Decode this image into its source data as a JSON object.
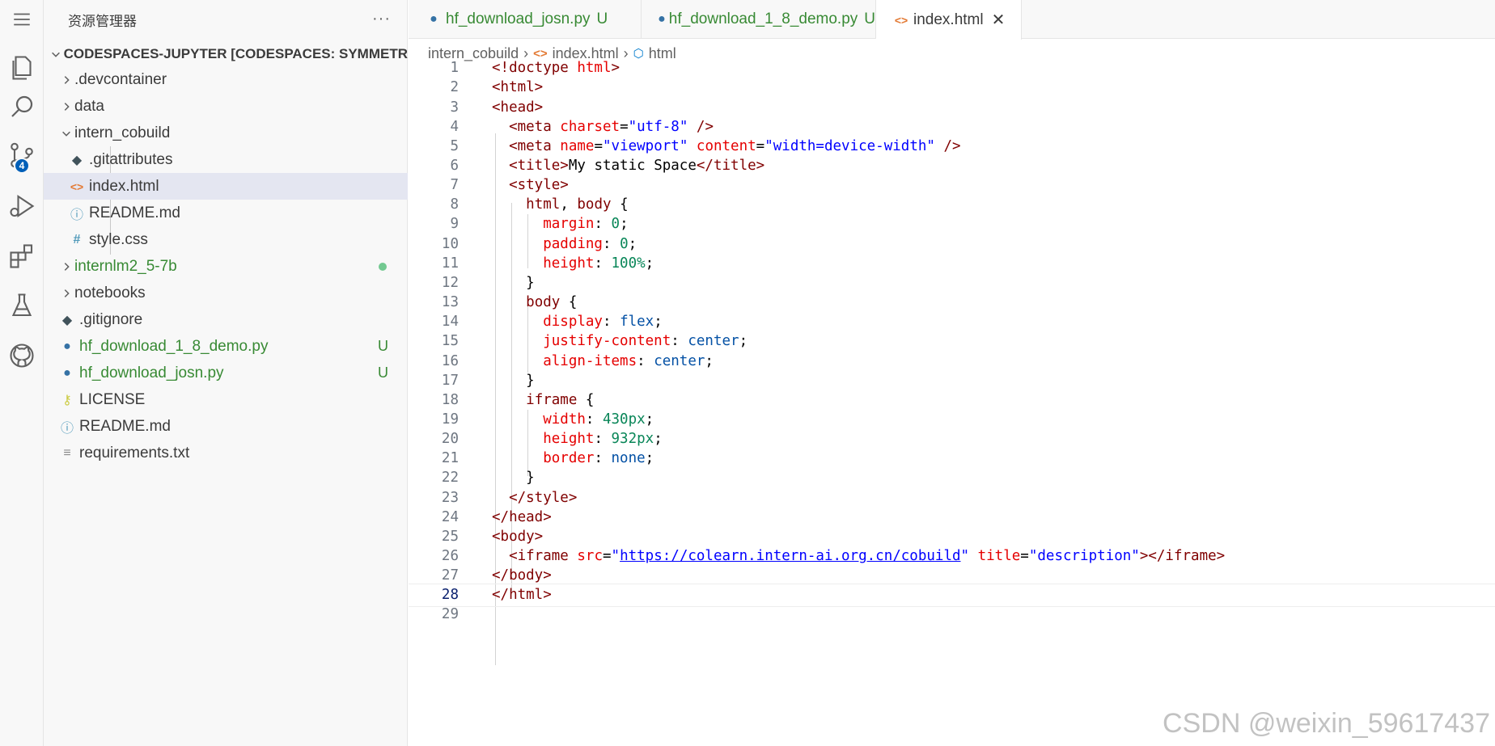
{
  "sidebar": {
    "title": "资源管理器",
    "root_label": "CODESPACES-JUPYTER [CODESPACES: SYMMETRIC...",
    "items": [
      {
        "label": ".devcontainer",
        "kind": "folder",
        "icon": "chevron-right-icon"
      },
      {
        "label": "data",
        "kind": "folder",
        "icon": "chevron-right-icon"
      },
      {
        "label": "intern_cobuild",
        "kind": "folder-open",
        "icon": "chevron-down-icon"
      },
      {
        "label": ".gitattributes",
        "kind": "file",
        "icon": "git-icon"
      },
      {
        "label": "index.html",
        "kind": "file",
        "icon": "html-icon",
        "selected": true
      },
      {
        "label": "README.md",
        "kind": "file",
        "icon": "info-icon"
      },
      {
        "label": "style.css",
        "kind": "file",
        "icon": "css-icon"
      },
      {
        "label": "internlm2_5-7b",
        "kind": "folder",
        "icon": "chevron-right-icon",
        "status": "dot"
      },
      {
        "label": "notebooks",
        "kind": "folder",
        "icon": "chevron-right-icon"
      },
      {
        "label": ".gitignore",
        "kind": "file",
        "icon": "git-icon"
      },
      {
        "label": "hf_download_1_8_demo.py",
        "kind": "file",
        "icon": "python-icon",
        "status": "U"
      },
      {
        "label": "hf_download_josn.py",
        "kind": "file",
        "icon": "python-icon",
        "status": "U"
      },
      {
        "label": "LICENSE",
        "kind": "file",
        "icon": "license-icon"
      },
      {
        "label": "README.md",
        "kind": "file",
        "icon": "info-icon"
      },
      {
        "label": "requirements.txt",
        "kind": "file",
        "icon": "text-file-icon"
      }
    ]
  },
  "activity": {
    "scm_badge": "4"
  },
  "tabs": [
    {
      "label": "hf_download_josn.py",
      "status": "U",
      "icon": "python-icon"
    },
    {
      "label": "hf_download_1_8_demo.py",
      "status": "U",
      "icon": "python-icon"
    },
    {
      "label": "index.html",
      "icon": "html-icon",
      "active": true
    }
  ],
  "breadcrumb": [
    "intern_cobuild",
    "index.html",
    "html"
  ],
  "editor": {
    "current_line": 28,
    "lines": [
      {
        "n": "1"
      },
      {
        "n": "2"
      },
      {
        "n": "3"
      },
      {
        "n": "4"
      },
      {
        "n": "5"
      },
      {
        "n": "6"
      },
      {
        "n": "7"
      },
      {
        "n": "8"
      },
      {
        "n": "9"
      },
      {
        "n": "10"
      },
      {
        "n": "11"
      },
      {
        "n": "12"
      },
      {
        "n": "13"
      },
      {
        "n": "14"
      },
      {
        "n": "15"
      },
      {
        "n": "16"
      },
      {
        "n": "17"
      },
      {
        "n": "18"
      },
      {
        "n": "19"
      },
      {
        "n": "20"
      },
      {
        "n": "21"
      },
      {
        "n": "22"
      },
      {
        "n": "23"
      },
      {
        "n": "24"
      },
      {
        "n": "25"
      },
      {
        "n": "26"
      },
      {
        "n": "27"
      },
      {
        "n": "28"
      },
      {
        "n": "29"
      }
    ],
    "code": [
      [
        [
          "tk-tag",
          "<!doctype "
        ],
        [
          "tk-attr",
          "html"
        ],
        [
          "tk-tag",
          ">"
        ]
      ],
      [
        [
          "tk-tag",
          "<html>"
        ]
      ],
      [
        [
          "tk-tag",
          "<head>"
        ]
      ],
      [
        [
          "tk-txt",
          "  "
        ],
        [
          "tk-tag",
          "<meta "
        ],
        [
          "tk-attr",
          "charset"
        ],
        [
          "tk-txt",
          "="
        ],
        [
          "tk-str",
          "\"utf-8\""
        ],
        [
          "tk-tag",
          " />"
        ]
      ],
      [
        [
          "tk-txt",
          "  "
        ],
        [
          "tk-tag",
          "<meta "
        ],
        [
          "tk-attr",
          "name"
        ],
        [
          "tk-txt",
          "="
        ],
        [
          "tk-str",
          "\"viewport\""
        ],
        [
          "tk-txt",
          " "
        ],
        [
          "tk-attr",
          "content"
        ],
        [
          "tk-txt",
          "="
        ],
        [
          "tk-str",
          "\"width=device-width\""
        ],
        [
          "tk-tag",
          " />"
        ]
      ],
      [
        [
          "tk-txt",
          "  "
        ],
        [
          "tk-tag",
          "<title>"
        ],
        [
          "tk-txt",
          "My static Space"
        ],
        [
          "tk-tag",
          "</title>"
        ]
      ],
      [
        [
          "tk-txt",
          "  "
        ],
        [
          "tk-tag",
          "<style>"
        ]
      ],
      [
        [
          "tk-txt",
          "    "
        ],
        [
          "tk-tag",
          "html"
        ],
        [
          "tk-txt",
          ", "
        ],
        [
          "tk-tag",
          "body"
        ],
        [
          "tk-txt",
          " {"
        ]
      ],
      [
        [
          "tk-txt",
          "      "
        ],
        [
          "tk-attr",
          "margin"
        ],
        [
          "tk-txt",
          ": "
        ],
        [
          "tk-num",
          "0"
        ],
        [
          "tk-txt",
          ";"
        ]
      ],
      [
        [
          "tk-txt",
          "      "
        ],
        [
          "tk-attr",
          "padding"
        ],
        [
          "tk-txt",
          ": "
        ],
        [
          "tk-num",
          "0"
        ],
        [
          "tk-txt",
          ";"
        ]
      ],
      [
        [
          "tk-txt",
          "      "
        ],
        [
          "tk-attr",
          "height"
        ],
        [
          "tk-txt",
          ": "
        ],
        [
          "tk-num",
          "100%"
        ],
        [
          "tk-txt",
          ";"
        ]
      ],
      [
        [
          "tk-txt",
          "    }"
        ]
      ],
      [
        [
          "tk-txt",
          "    "
        ],
        [
          "tk-tag",
          "body"
        ],
        [
          "tk-txt",
          " {"
        ]
      ],
      [
        [
          "tk-txt",
          "      "
        ],
        [
          "tk-attr",
          "display"
        ],
        [
          "tk-txt",
          ": "
        ],
        [
          "tk-val",
          "flex"
        ],
        [
          "tk-txt",
          ";"
        ]
      ],
      [
        [
          "tk-txt",
          "      "
        ],
        [
          "tk-attr",
          "justify-content"
        ],
        [
          "tk-txt",
          ": "
        ],
        [
          "tk-val",
          "center"
        ],
        [
          "tk-txt",
          ";"
        ]
      ],
      [
        [
          "tk-txt",
          "      "
        ],
        [
          "tk-attr",
          "align-items"
        ],
        [
          "tk-txt",
          ": "
        ],
        [
          "tk-val",
          "center"
        ],
        [
          "tk-txt",
          ";"
        ]
      ],
      [
        [
          "tk-txt",
          "    }"
        ]
      ],
      [
        [
          "tk-txt",
          "    "
        ],
        [
          "tk-tag",
          "iframe"
        ],
        [
          "tk-txt",
          " {"
        ]
      ],
      [
        [
          "tk-txt",
          "      "
        ],
        [
          "tk-attr",
          "width"
        ],
        [
          "tk-txt",
          ": "
        ],
        [
          "tk-num",
          "430px"
        ],
        [
          "tk-txt",
          ";"
        ]
      ],
      [
        [
          "tk-txt",
          "      "
        ],
        [
          "tk-attr",
          "height"
        ],
        [
          "tk-txt",
          ": "
        ],
        [
          "tk-num",
          "932px"
        ],
        [
          "tk-txt",
          ";"
        ]
      ],
      [
        [
          "tk-txt",
          "      "
        ],
        [
          "tk-attr",
          "border"
        ],
        [
          "tk-txt",
          ": "
        ],
        [
          "tk-val",
          "none"
        ],
        [
          "tk-txt",
          ";"
        ]
      ],
      [
        [
          "tk-txt",
          "    }"
        ]
      ],
      [
        [
          "tk-txt",
          "  "
        ],
        [
          "tk-tag",
          "</style>"
        ]
      ],
      [
        [
          "tk-tag",
          "</head>"
        ]
      ],
      [
        [
          "tk-tag",
          "<body>"
        ]
      ],
      [
        [
          "tk-txt",
          "  "
        ],
        [
          "tk-tag",
          "<iframe "
        ],
        [
          "tk-attr",
          "src"
        ],
        [
          "tk-txt",
          "="
        ],
        [
          "tk-str",
          "\""
        ],
        [
          "tk-link",
          "https://colearn.intern-ai.org.cn/cobuild"
        ],
        [
          "tk-str",
          "\""
        ],
        [
          "tk-txt",
          " "
        ],
        [
          "tk-attr",
          "title"
        ],
        [
          "tk-txt",
          "="
        ],
        [
          "tk-str",
          "\"description\""
        ],
        [
          "tk-tag",
          "></iframe>"
        ]
      ],
      [
        [
          "tk-tag",
          "</body>"
        ]
      ],
      [
        [
          "tk-tag",
          "</html>"
        ]
      ],
      []
    ]
  },
  "watermark": "CSDN @weixin_59617437"
}
